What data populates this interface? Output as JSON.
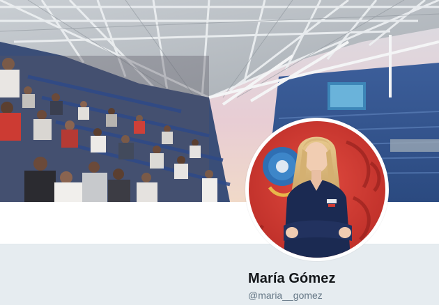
{
  "profile": {
    "display_name": "María Gómez",
    "handle": "@maria__gomez"
  },
  "banner": {
    "image": "stadium-crowd-photo"
  },
  "avatar": {
    "image": "profile-photo-woman-red-world-cup-backdrop"
  },
  "colors": {
    "page_background": "#e6ecf0",
    "card_background": "#ffffff",
    "name_text": "#14171a",
    "handle_text": "#657786",
    "avatar_backdrop": "#d23a33",
    "shirt": "#1b2a52"
  }
}
